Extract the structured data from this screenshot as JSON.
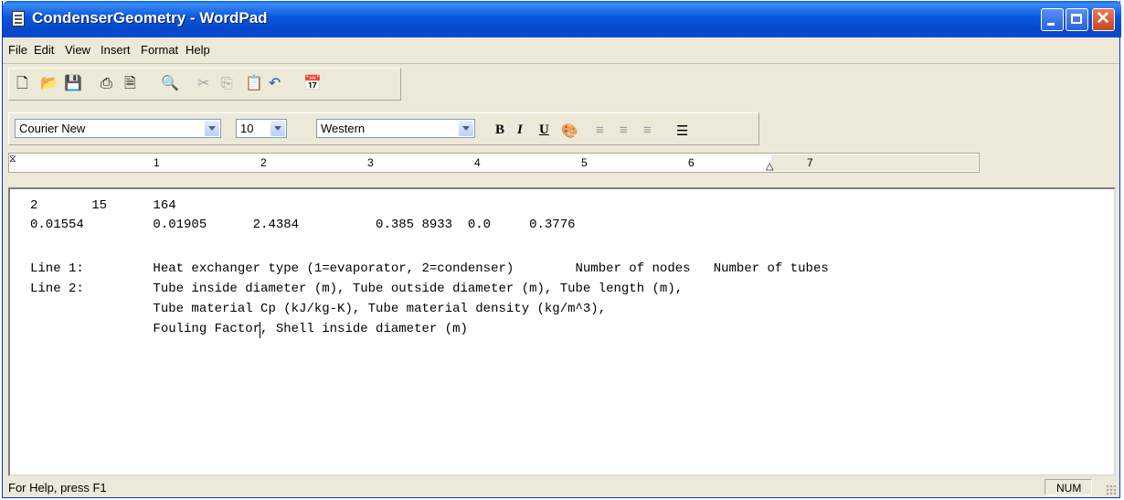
{
  "window": {
    "title": "CondenserGeometry - WordPad",
    "minimize_label": "_",
    "maximize_label": "□",
    "close_label": "✕"
  },
  "menu": [
    "File",
    "Edit",
    "View",
    "Insert",
    "Format",
    "Help"
  ],
  "toolbar": {
    "icons": [
      "new-icon",
      "open-icon",
      "save-icon",
      "print-icon",
      "print-preview-icon",
      "find-icon",
      "cut-icon",
      "copy-icon",
      "paste-icon",
      "undo-icon",
      "insert-datetime-icon"
    ]
  },
  "format_bar": {
    "font": "Courier New",
    "size": "10",
    "script": "Western",
    "bold": "B",
    "italic": "I",
    "underline": "U"
  },
  "ruler": {
    "numbers": [
      "1",
      "2",
      "3",
      "4",
      "5",
      "6",
      "7"
    ]
  },
  "document": {
    "lines": [
      "2       15      164",
      "0.01554         0.01905      2.4384          0.385 8933  0.0     0.3776",
      "",
      "Line 1:         Heat exchanger type (1=evaporator, 2=condenser)        Number of nodes   Number of tubes",
      "Line 2:         Tube inside diameter (m), Tube outside diameter (m), Tube length (m),",
      "                Tube material Cp (kJ/kg-K), Tube material density (kg/m^3),",
      "                Fouling Factor, Shell inside diameter (m)"
    ]
  },
  "status": {
    "help_text": "For Help, press F1",
    "num_lock": "NUM"
  },
  "colors": {
    "title_bar": "#0855dd",
    "chrome": "#ece9d8",
    "close_button": "#c6461e"
  }
}
